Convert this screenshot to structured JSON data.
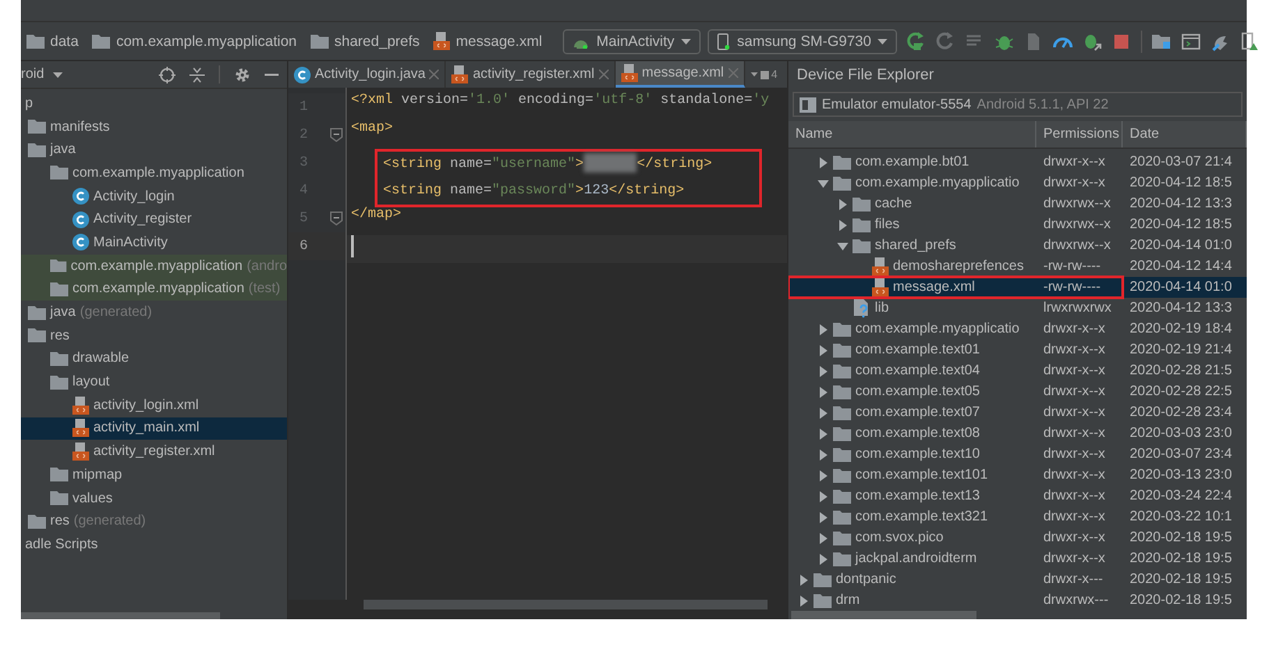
{
  "toolbar": {
    "breadcrumbs": [
      {
        "label": "data",
        "kind": "folder"
      },
      {
        "label": "com.example.myapplication",
        "kind": "folder"
      },
      {
        "label": "shared_prefs",
        "kind": "folder"
      },
      {
        "label": "message.xml",
        "kind": "xml"
      }
    ],
    "run_config": "MainActivity",
    "device": "samsung SM-G9730"
  },
  "project_panel": {
    "view_label": "roid",
    "tree": [
      {
        "label": "p",
        "selected": false,
        "tinted": false,
        "children": [
          {
            "label": "manifests",
            "kind": "folder",
            "selected": false,
            "tinted": false
          },
          {
            "label": "java",
            "kind": "folder",
            "selected": false,
            "tinted": false,
            "children": [
              {
                "label": "com.example.myapplication",
                "kind": "folder",
                "selected": false,
                "tinted": false,
                "children": [
                  {
                    "label": "Activity_login",
                    "kind": "class",
                    "selected": false,
                    "tinted": false
                  },
                  {
                    "label": "Activity_register",
                    "kind": "class",
                    "selected": false,
                    "tinted": false
                  },
                  {
                    "label": "MainActivity",
                    "kind": "class",
                    "selected": false,
                    "tinted": false
                  }
                ]
              },
              {
                "label": "com.example.myapplication",
                "suffix": "(andro",
                "kind": "folder",
                "selected": false,
                "tinted": true
              },
              {
                "label": "com.example.myapplication",
                "suffix": "(test)",
                "kind": "folder",
                "selected": false,
                "tinted": true
              }
            ]
          },
          {
            "label": "java",
            "suffix": "(generated)",
            "kind": "folder",
            "selected": false,
            "tinted": false
          },
          {
            "label": "res",
            "kind": "folder",
            "selected": false,
            "tinted": false,
            "children": [
              {
                "label": "drawable",
                "kind": "folder",
                "selected": false,
                "tinted": false
              },
              {
                "label": "layout",
                "kind": "folder",
                "selected": false,
                "tinted": false,
                "children": [
                  {
                    "label": "activity_login.xml",
                    "kind": "xml",
                    "selected": false,
                    "tinted": false
                  },
                  {
                    "label": "activity_main.xml",
                    "kind": "xml",
                    "selected": true,
                    "tinted": false
                  },
                  {
                    "label": "activity_register.xml",
                    "kind": "xml",
                    "selected": false,
                    "tinted": false
                  }
                ]
              },
              {
                "label": "mipmap",
                "kind": "folder",
                "selected": false,
                "tinted": false
              },
              {
                "label": "values",
                "kind": "folder",
                "selected": false,
                "tinted": false
              }
            ]
          },
          {
            "label": "res",
            "suffix": "(generated)",
            "kind": "folder",
            "selected": false,
            "tinted": false
          }
        ]
      },
      {
        "label": "adle Scripts",
        "selected": false,
        "tinted": false
      }
    ]
  },
  "editor": {
    "tabs": [
      {
        "label": "Activity_login.java",
        "kind": "class",
        "selected": false
      },
      {
        "label": "activity_register.xml",
        "kind": "xml",
        "selected": false
      },
      {
        "label": "message.xml",
        "kind": "xml",
        "selected": true
      }
    ],
    "tab_overflow_count": "4",
    "lines": [
      {
        "number": "1",
        "fold": false,
        "boxed": false,
        "current": false,
        "tokens": [
          {
            "t": "<?xml ",
            "kind": "tag"
          },
          {
            "t": "version=",
            "kind": "attr"
          },
          {
            "t": "'1.0' ",
            "kind": "str"
          },
          {
            "t": "encoding=",
            "kind": "attr"
          },
          {
            "t": "'utf-8' ",
            "kind": "str"
          },
          {
            "t": "standalone=",
            "kind": "attr"
          },
          {
            "t": "'y",
            "kind": "str"
          }
        ]
      },
      {
        "number": "2",
        "fold": true,
        "boxed": false,
        "current": false,
        "tokens": [
          {
            "t": "<map>",
            "kind": "tag"
          }
        ]
      },
      {
        "number": "3",
        "fold": false,
        "boxed": true,
        "current": false,
        "tokens": [
          {
            "t": "<string ",
            "kind": "tag"
          },
          {
            "t": "name=",
            "kind": "attr"
          },
          {
            "t": "\"username\"",
            "kind": "str"
          },
          {
            "t": ">",
            "kind": "tag"
          },
          {
            "kind": "redacted"
          },
          {
            "t": "</string>",
            "kind": "tag"
          }
        ]
      },
      {
        "number": "4",
        "fold": false,
        "boxed": true,
        "current": false,
        "tokens": [
          {
            "t": "<string ",
            "kind": "tag"
          },
          {
            "t": "name=",
            "kind": "attr"
          },
          {
            "t": "\"password\"",
            "kind": "str"
          },
          {
            "t": ">",
            "kind": "tag"
          },
          {
            "t": "123",
            "kind": "text"
          },
          {
            "t": "</string>",
            "kind": "tag"
          }
        ]
      },
      {
        "number": "5",
        "fold": true,
        "boxed": false,
        "current": false,
        "tokens": [
          {
            "t": "</map>",
            "kind": "tag"
          }
        ]
      },
      {
        "number": "6",
        "fold": false,
        "boxed": false,
        "current": true
      }
    ]
  },
  "device_explorer": {
    "title": "Device File Explorer",
    "device": {
      "name": "Emulator emulator-5554",
      "detail": "Android 5.1.1, API 22"
    },
    "columns": [
      "Name",
      "Permissions",
      "Date"
    ],
    "continued_rows": [
      {
        "name": "com.example.bt01",
        "kind": "folder",
        "expanded": false,
        "permissions": "drwxr-x--x",
        "date": "2020-03-07 21:4",
        "selected": false,
        "boxed": false
      },
      {
        "name": "com.example.myapplicatio",
        "kind": "folder",
        "expanded": true,
        "permissions": "drwxr-x--x",
        "date": "2020-04-12 18:5",
        "selected": false,
        "boxed": false,
        "children": [
          {
            "name": "cache",
            "kind": "folder",
            "expanded": false,
            "permissions": "drwxrwx--x",
            "date": "2020-04-12 13:3",
            "selected": false,
            "boxed": false
          },
          {
            "name": "files",
            "kind": "folder",
            "expanded": false,
            "permissions": "drwxrwx--x",
            "date": "2020-04-12 18:5",
            "selected": false,
            "boxed": false
          },
          {
            "name": "shared_prefs",
            "kind": "folder",
            "expanded": true,
            "permissions": "drwxrwx--x",
            "date": "2020-04-14 01:0",
            "selected": false,
            "boxed": false,
            "children": [
              {
                "name": "demoshareprefences",
                "kind": "xml",
                "permissions": "-rw-rw----",
                "date": "2020-04-12 14:4",
                "selected": false,
                "boxed": false
              },
              {
                "name": "message.xml",
                "kind": "xml",
                "permissions": "-rw-rw----",
                "date": "2020-04-14 01:0",
                "selected": true,
                "boxed": true
              }
            ]
          },
          {
            "name": "lib",
            "kind": "link",
            "permissions": "lrwxrwxrwx",
            "date": "2020-04-12 13:3",
            "selected": false,
            "boxed": false
          }
        ]
      },
      {
        "name": "com.example.myapplicatio",
        "kind": "folder",
        "expanded": false,
        "permissions": "drwxr-x--x",
        "date": "2020-02-19 18:4",
        "selected": false,
        "boxed": false
      },
      {
        "name": "com.example.text01",
        "kind": "folder",
        "expanded": false,
        "permissions": "drwxr-x--x",
        "date": "2020-02-19 21:4",
        "selected": false,
        "boxed": false
      },
      {
        "name": "com.example.text04",
        "kind": "folder",
        "expanded": false,
        "permissions": "drwxr-x--x",
        "date": "2020-02-28 21:5",
        "selected": false,
        "boxed": false
      },
      {
        "name": "com.example.text05",
        "kind": "folder",
        "expanded": false,
        "permissions": "drwxr-x--x",
        "date": "2020-02-28 22:5",
        "selected": false,
        "boxed": false
      },
      {
        "name": "com.example.text07",
        "kind": "folder",
        "expanded": false,
        "permissions": "drwxr-x--x",
        "date": "2020-02-28 23:4",
        "selected": false,
        "boxed": false
      },
      {
        "name": "com.example.text08",
        "kind": "folder",
        "expanded": false,
        "permissions": "drwxr-x--x",
        "date": "2020-03-03 23:0",
        "selected": false,
        "boxed": false
      },
      {
        "name": "com.example.text10",
        "kind": "folder",
        "expanded": false,
        "permissions": "drwxr-x--x",
        "date": "2020-03-07 23:4",
        "selected": false,
        "boxed": false
      },
      {
        "name": "com.example.text101",
        "kind": "folder",
        "expanded": false,
        "permissions": "drwxr-x--x",
        "date": "2020-03-13 23:0",
        "selected": false,
        "boxed": false
      },
      {
        "name": "com.example.text13",
        "kind": "folder",
        "expanded": false,
        "permissions": "drwxr-x--x",
        "date": "2020-03-24 22:4",
        "selected": false,
        "boxed": false
      },
      {
        "name": "com.example.text321",
        "kind": "folder",
        "expanded": false,
        "permissions": "drwxr-x--x",
        "date": "2020-03-22 10:1",
        "selected": false,
        "boxed": false
      },
      {
        "name": "com.svox.pico",
        "kind": "folder",
        "expanded": false,
        "permissions": "drwxr-x--x",
        "date": "2020-02-18 19:5",
        "selected": false,
        "boxed": false
      },
      {
        "name": "jackpal.androidterm",
        "kind": "folder",
        "expanded": false,
        "permissions": "drwxr-x--x",
        "date": "2020-02-18 19:5",
        "selected": false,
        "boxed": false
      }
    ],
    "rows": [
      {
        "name": "dontpanic",
        "kind": "folder",
        "expanded": false,
        "permissions": "drwxr-x---",
        "date": "2020-02-18 19:5",
        "selected": false,
        "boxed": false
      },
      {
        "name": "drm",
        "kind": "folder",
        "expanded": false,
        "permissions": "drwxrwx---",
        "date": "2020-02-18 19:5",
        "selected": false,
        "boxed": false
      }
    ]
  }
}
